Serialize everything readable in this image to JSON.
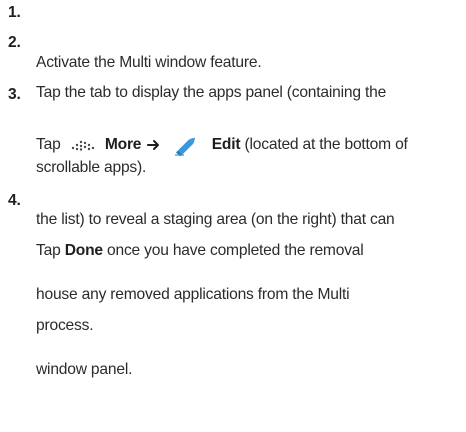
{
  "steps": [
    {
      "number": "1.",
      "line1": "Activate the Multi window feature."
    },
    {
      "number": "2.",
      "line1": "Tap the tab to display the apps panel (containing the",
      "line2": "scrollable apps)."
    },
    {
      "number": "3.",
      "pre": "Tap",
      "more_label": "More",
      "edit_label": "Edit",
      "post": "(located at the bottom of",
      "line2": "the list) to reveal a staging area (on the right) that can",
      "line3": "house any removed applications from the Multi",
      "line4": "window panel."
    },
    {
      "number": "4.",
      "pre": "Tap",
      "done_label": "Done",
      "post": "once you have completed the removal",
      "line2": "process."
    }
  ],
  "icons": {
    "more": "more-dots-icon",
    "arrow": "right-arrow-icon",
    "edit": "pencil-edit-icon"
  },
  "colors": {
    "text": "#2b2b2b",
    "pencil": "#3a98d8",
    "more_dots": "#4a4a4a"
  }
}
